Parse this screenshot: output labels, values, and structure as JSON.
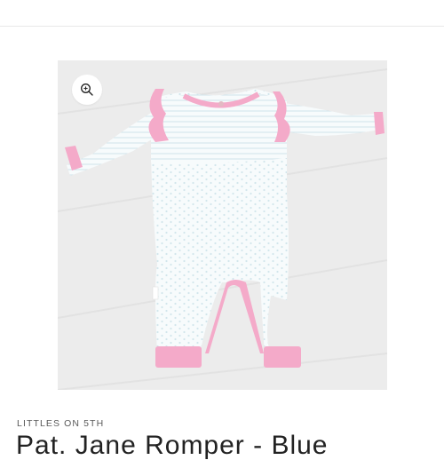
{
  "product": {
    "vendor": "LITTLES ON 5TH",
    "title": "Pat. Jane Romper - Blue",
    "image_alt": "Pat. Jane Romper - Blue"
  },
  "icons": {
    "zoom": "zoom-in-icon"
  },
  "colors": {
    "trim_pink": "#f4aac9",
    "fabric_white": "#f7fbfc",
    "stripe_blue": "#cfe3ea",
    "floor_gray": "#ececec"
  }
}
